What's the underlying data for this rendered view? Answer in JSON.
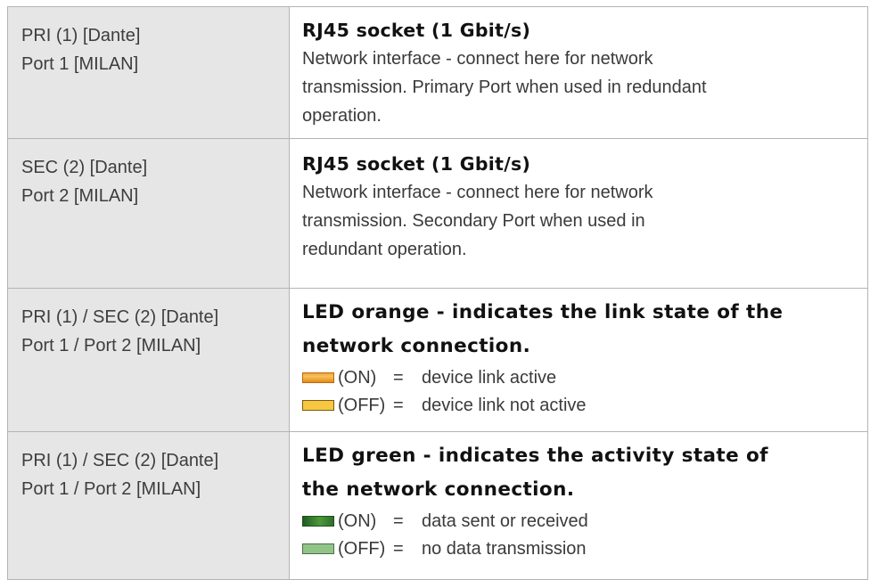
{
  "rows": [
    {
      "left": [
        "PRI (1) [Dante]",
        "Port 1 [MILAN]"
      ],
      "heading": "RJ45 socket (1 Gbit/s)",
      "body": [
        "Network interface - connect here for network",
        "transmission. Primary Port when used in redundant",
        "operation."
      ]
    },
    {
      "left": [
        "SEC (2) [Dante]",
        "Port 2 [MILAN]"
      ],
      "heading": "RJ45 socket (1 Gbit/s)",
      "body": [
        "Network interface - connect here for network",
        "transmission. Secondary Port when used in",
        "redundant operation."
      ]
    },
    {
      "left": [
        "PRI (1) / SEC (2) [Dante]",
        "Port 1 / Port 2 [MILAN]"
      ],
      "heading": [
        "LED orange - indicates the link state of the",
        "network connection."
      ],
      "leds": [
        {
          "icon": "orange-led-on-swatch",
          "color": "#f2a43a",
          "state": "(ON)",
          "equals": "=",
          "meaning": "device link active"
        },
        {
          "icon": "orange-led-off-swatch",
          "color": "#f6c742",
          "state": "(OFF)",
          "equals": "=",
          "meaning": "device link not active"
        }
      ]
    },
    {
      "left": [
        "PRI (1) / SEC (2) [Dante]",
        "Port 1 / Port 2 [MILAN]"
      ],
      "heading": [
        "LED green - indicates the activity state of",
        "the network connection."
      ],
      "leds": [
        {
          "icon": "green-led-on-swatch",
          "color": "#2d6f2a",
          "state": "(ON)",
          "equals": "=",
          "meaning": "data sent or received"
        },
        {
          "icon": "green-led-off-swatch",
          "color": "#92c48a",
          "state": "(OFF)",
          "equals": "=",
          "meaning": "no data transmission"
        }
      ]
    }
  ],
  "colors": {
    "label_cell_background": "#e6e6e6",
    "border": "#b4b4b4"
  }
}
